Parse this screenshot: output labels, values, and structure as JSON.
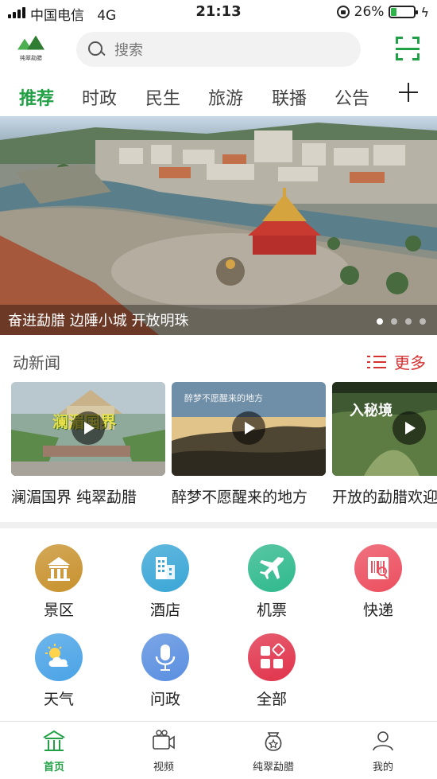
{
  "status_bar": {
    "carrier": "中国电信",
    "network": "4G",
    "time": "21:13",
    "battery_percent": "26%",
    "battery_level": 0.26
  },
  "header": {
    "logo_text": "纯翠勐腊",
    "search_placeholder": "搜索"
  },
  "tabs": [
    {
      "label": "推荐",
      "active": true
    },
    {
      "label": "时政",
      "active": false
    },
    {
      "label": "民生",
      "active": false
    },
    {
      "label": "旅游",
      "active": false
    },
    {
      "label": "联播",
      "active": false
    },
    {
      "label": "公告",
      "active": false
    }
  ],
  "banner": {
    "caption": "奋进勐腊 边陲小城 开放明珠",
    "slide_count": 4,
    "active_slide": 1
  },
  "news": {
    "title": "动新闻",
    "more_label": "更多",
    "videos": [
      {
        "title": "澜湄国界 纯翠勐腊",
        "overlay": "澜湄国界"
      },
      {
        "title": "醉梦不愿醒来的地方",
        "overlay": "醉梦不愿醒来的地方"
      },
      {
        "title": "开放的勐腊欢迎",
        "overlay": "入秘境"
      }
    ]
  },
  "services": [
    {
      "label": "景区",
      "icon": "scenic-icon",
      "color": "#c8922e"
    },
    {
      "label": "酒店",
      "icon": "hotel-icon",
      "color": "#3aa6d6"
    },
    {
      "label": "机票",
      "icon": "plane-icon",
      "color": "#2fb98c"
    },
    {
      "label": "快递",
      "icon": "express-icon",
      "color": "#ec4f5f"
    },
    {
      "label": "天气",
      "icon": "weather-icon",
      "color": "#4aa3e6"
    },
    {
      "label": "问政",
      "icon": "microphone-icon",
      "color": "#5a8fe0"
    },
    {
      "label": "全部",
      "icon": "all-icon",
      "color": "#e0334b"
    }
  ],
  "bottom_nav": [
    {
      "label": "首页",
      "icon": "home-icon",
      "active": true
    },
    {
      "label": "视频",
      "icon": "video-icon",
      "active": false
    },
    {
      "label": "纯翠勐腊",
      "icon": "bag-icon",
      "active": false
    },
    {
      "label": "我的",
      "icon": "user-icon",
      "active": false
    }
  ],
  "colors": {
    "accent": "#22a046",
    "more": "#d63030"
  }
}
